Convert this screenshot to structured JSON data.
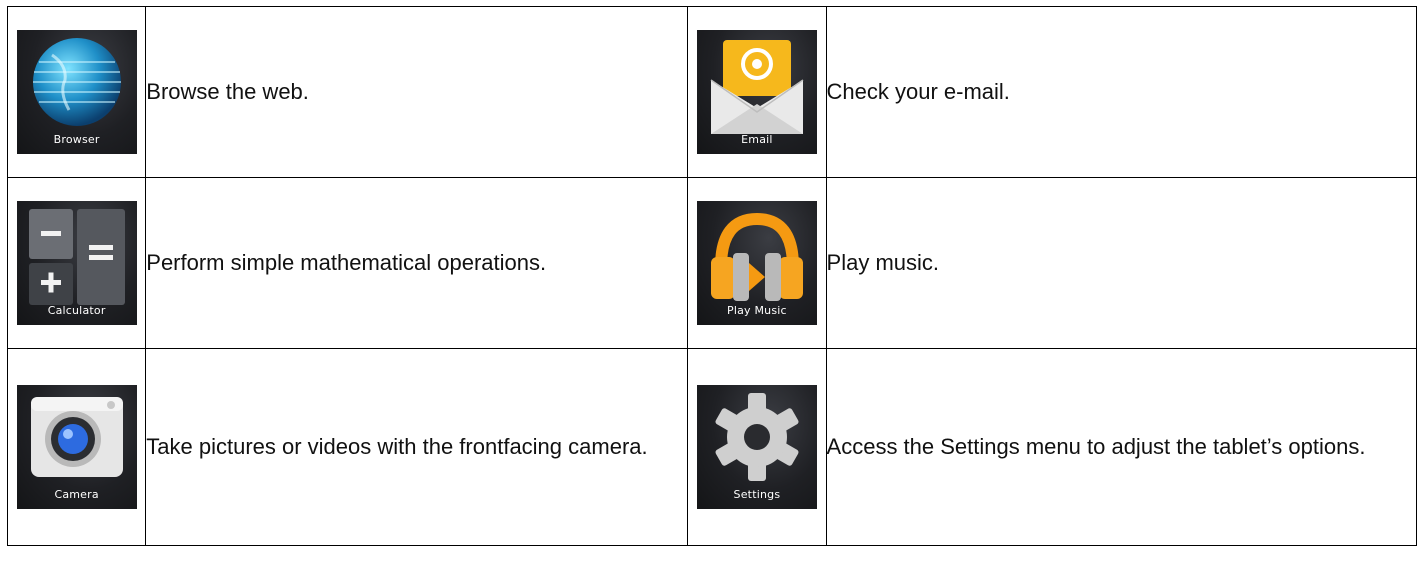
{
  "apps": [
    {
      "left": {
        "icon": "browser-globe-icon",
        "icon_label": "Browser",
        "description": "Browse the web."
      },
      "right": {
        "icon": "email-envelope-icon",
        "icon_label": "Email",
        "description": "Check your e-mail."
      }
    },
    {
      "left": {
        "icon": "calculator-icon",
        "icon_label": "Calculator",
        "description": "Perform simple mathematical operations."
      },
      "right": {
        "icon": "play-music-headphones-icon",
        "icon_label": "Play Music",
        "description": "Play music."
      }
    },
    {
      "left": {
        "icon": "camera-icon",
        "icon_label": "Camera",
        "description": "Take pictures or videos with the frontfacing camera."
      },
      "right": {
        "icon": "settings-gear-icon",
        "icon_label": "Settings",
        "description": "Access the Settings menu to adjust the tablet’s options."
      }
    }
  ]
}
